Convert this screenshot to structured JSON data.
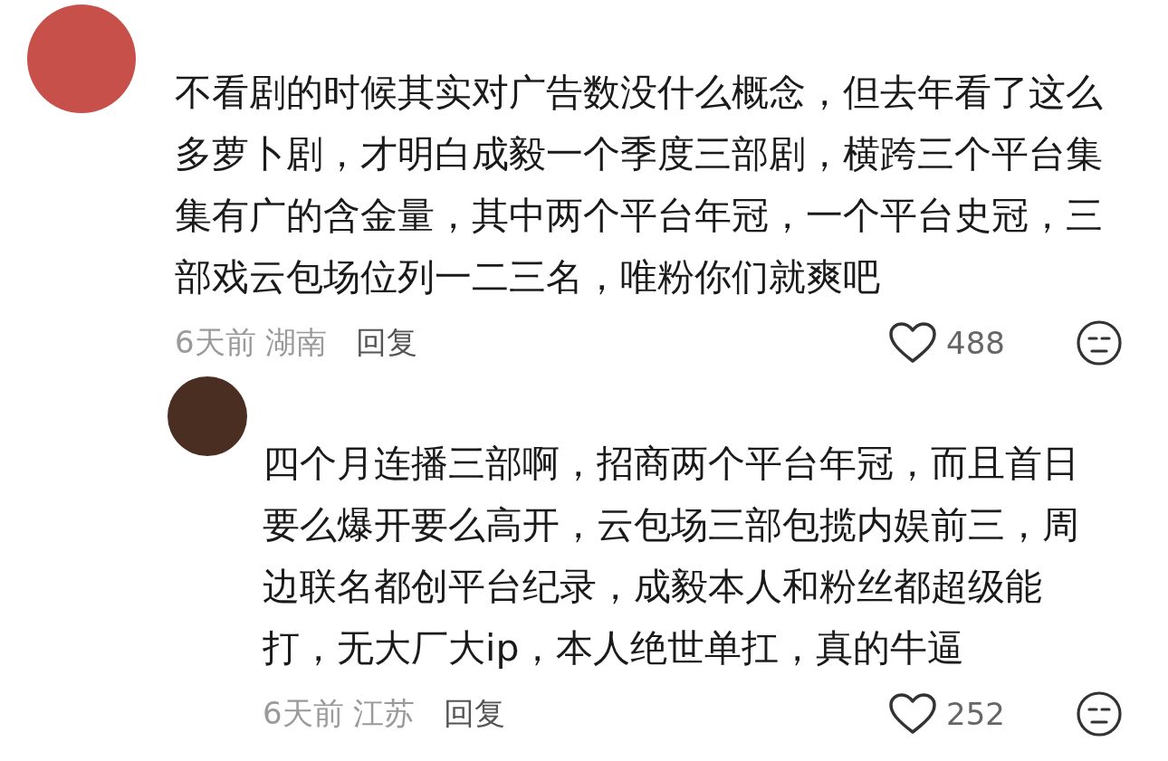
{
  "comments": [
    {
      "kind": "comment",
      "text": "不看剧的时候其实对广告数没什么概念，但去年看了这么多萝卜剧，才明白成毅一个季度三部剧，横跨三个平台集集有广的含金量，其中两个平台年冠，一个平台史冠，三部戏云包场位列一二三名，唯粉你们就爽吧",
      "time": "6天前",
      "location": "湖南",
      "reply_label": "回复",
      "likes": "488"
    },
    {
      "kind": "reply",
      "text": "四个月连播三部啊，招商两个平台年冠，而且首日要么爆开要么高开，云包场三部包揽内娱前三，周边联名都创平台纪录，成毅本人和粉丝都超级能打，无大厂大ip，本人绝世单扛，真的牛逼",
      "time": "6天前",
      "location": "江苏",
      "reply_label": "回复",
      "likes": "252"
    }
  ]
}
